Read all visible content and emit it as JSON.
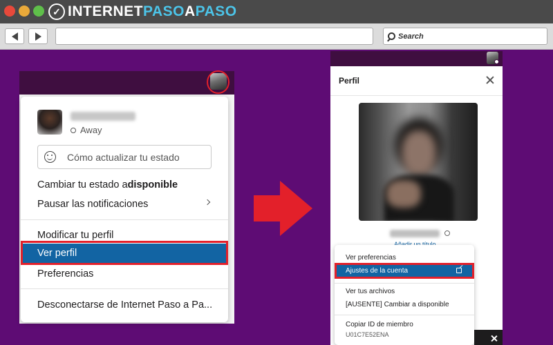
{
  "browser": {
    "logo_prefix": "INTERNET",
    "logo_accent_1": "PASO",
    "logo_mid": "A",
    "logo_accent_2": "PASO",
    "search_placeholder": "Search"
  },
  "colors": {
    "background": "#5e0c74",
    "slack_aubergine": "#3f0e40",
    "selection_blue": "#1264a3",
    "highlight_red": "#e3202a"
  },
  "left_menu": {
    "status": "Away",
    "status_input_placeholder": "Cómo actualizar tu estado",
    "set_status_prefix": "Cambiar tu estado a ",
    "set_status_bold": "disponible",
    "pause_notifications": "Pausar las notificaciones",
    "edit_profile": "Modificar tu perfil",
    "view_profile": "Ver perfil",
    "preferences": "Preferencias",
    "sign_out": "Desconectarse de Internet Paso a Pa..."
  },
  "right_panel": {
    "title": "Perfil",
    "add_title_link": "Añadir un título",
    "dropdown": {
      "view_preferences": "Ver preferencias",
      "account_settings": "Ajustes de la cuenta",
      "view_files": "Ver tus archivos",
      "set_available": "[AUSENTE] Cambiar a disponible",
      "copy_member_id": "Copiar ID de miembro",
      "member_id": "U01C7E52ENA"
    }
  }
}
